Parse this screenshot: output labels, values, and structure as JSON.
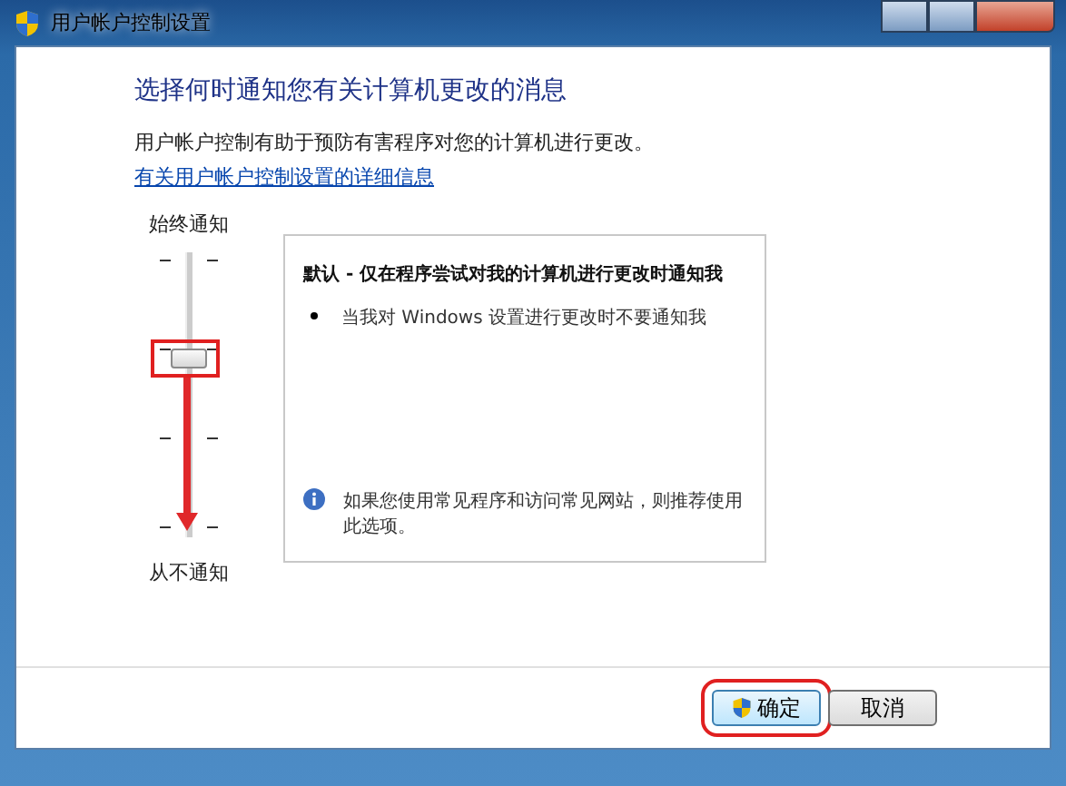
{
  "window": {
    "title": "用户帐户控制设置"
  },
  "heading": "选择何时通知您有关计算机更改的消息",
  "description": "用户帐户控制有助于预防有害程序对您的计算机进行更改。",
  "link": "有关用户帐户控制设置的详细信息",
  "slider": {
    "top_label": "始终通知",
    "bottom_label": "从不通知",
    "level": 0.67
  },
  "info": {
    "title": "默认 - 仅在程序尝试对我的计算机进行更改时通知我",
    "bullets": [
      "当我对 Windows 设置进行更改时不要通知我"
    ],
    "note": "如果您使用常见程序和访问常见网站，则推荐使用此选项。"
  },
  "buttons": [
    {
      "label": "确定",
      "kind": "shield",
      "highlighted": true
    },
    {
      "label": "取消",
      "kind": "plain",
      "highlighted": false
    }
  ]
}
